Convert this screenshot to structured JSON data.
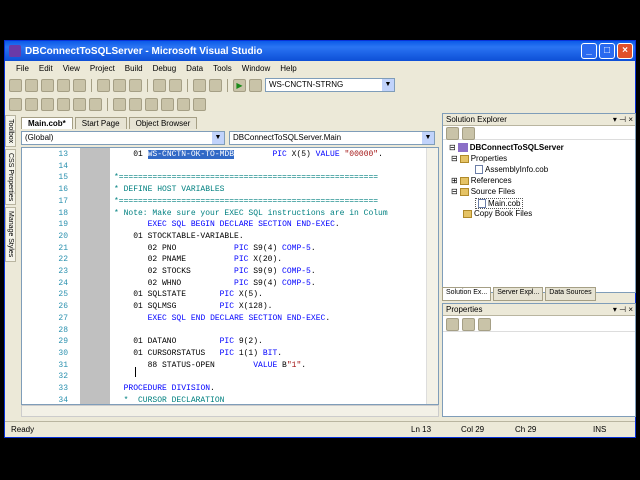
{
  "window": {
    "title": "DBConnectToSQLServer - Microsoft Visual Studio"
  },
  "menu": [
    "File",
    "Edit",
    "View",
    "Project",
    "Build",
    "Debug",
    "Data",
    "Tools",
    "Window",
    "Help"
  ],
  "toolbar": {
    "config_combo": "WS-CNCTN-STRNG"
  },
  "left_tabs": [
    "Toolbox",
    "CSS Properties",
    "Manage Styles"
  ],
  "doc_tabs": [
    "Main.cob*",
    "Start Page",
    "Object Browser"
  ],
  "editor": {
    "scope_combo": "(Global)",
    "member_combo": "DBConnectToSQLServer.Main",
    "lines": [
      {
        "n": "13",
        "text": "    01 WS-CNCTN-OK-TO-MDB        PIC X(5) VALUE \"00000\"."
      },
      {
        "n": "14",
        "text": ""
      },
      {
        "n": "15",
        "text": "*======================================================"
      },
      {
        "n": "16",
        "text": "* DEFINE HOST VARIABLES"
      },
      {
        "n": "17",
        "text": "*======================================================"
      },
      {
        "n": "18",
        "text": "* Note: Make sure your EXEC SQL instructions are in Colum"
      },
      {
        "n": "19",
        "text": "       EXEC SQL BEGIN DECLARE SECTION END-EXEC."
      },
      {
        "n": "20",
        "text": "    01 STOCKTABLE-VARIABLE."
      },
      {
        "n": "21",
        "text": "       02 PNO            PIC S9(4) COMP-5."
      },
      {
        "n": "22",
        "text": "       02 PNAME          PIC X(20)."
      },
      {
        "n": "23",
        "text": "       02 STOCKS         PIC S9(9) COMP-5."
      },
      {
        "n": "24",
        "text": "       02 WHNO           PIC S9(4) COMP-5."
      },
      {
        "n": "25",
        "text": "    01 SQLSTATE       PIC X(5)."
      },
      {
        "n": "26",
        "text": "    01 SQLMSG         PIC X(128)."
      },
      {
        "n": "27",
        "text": "       EXEC SQL END DECLARE SECTION END-EXEC."
      },
      {
        "n": "28",
        "text": ""
      },
      {
        "n": "29",
        "text": "    01 DATANO         PIC 9(2)."
      },
      {
        "n": "30",
        "text": "    01 CURSORSTATUS   PIC 1(1) BIT."
      },
      {
        "n": "31",
        "text": "       88 STATUS-OPEN        VALUE B\"1\"."
      },
      {
        "n": "32",
        "text": ""
      },
      {
        "n": "33",
        "text": "  PROCEDURE DIVISION."
      },
      {
        "n": "34",
        "text": "  *  CURSOR DECLARATION"
      }
    ]
  },
  "solution_explorer": {
    "title": "Solution Explorer",
    "nodes": [
      "DBConnectToSQLServer",
      "Properties",
      "AssemblyInfo.cob",
      "References",
      "Source Files",
      "Main.cob",
      "Copy Book Files"
    ]
  },
  "side_tabs": [
    "Solution Ex...",
    "Server Expl...",
    "Data Sources"
  ],
  "properties": {
    "title": "Properties"
  },
  "status": {
    "ready": "Ready",
    "ln": "Ln 13",
    "col": "Col 29",
    "ch": "Ch 29",
    "ins": "INS"
  }
}
